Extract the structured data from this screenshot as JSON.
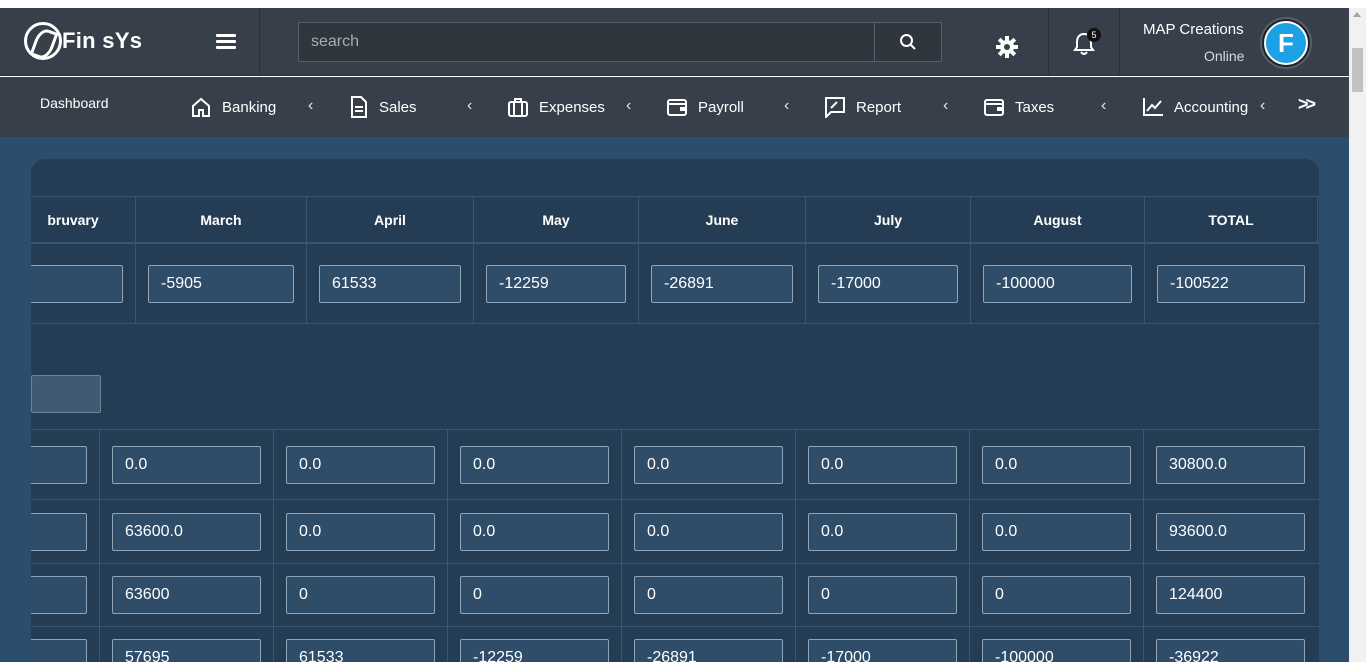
{
  "header": {
    "logo_text": "Fin sYs",
    "search_placeholder": "search",
    "notification_count": "5",
    "user_name": "MAP Creations",
    "user_status": "Online",
    "avatar_letter": "F"
  },
  "nav": {
    "items": [
      {
        "label": "Dashboard",
        "icon": "none"
      },
      {
        "label": "Banking",
        "icon": "home-icon"
      },
      {
        "label": "Sales",
        "icon": "document-icon"
      },
      {
        "label": "Expenses",
        "icon": "briefcase-icon"
      },
      {
        "label": "Payroll",
        "icon": "wallet-icon"
      },
      {
        "label": "Report",
        "icon": "edit-chart-icon"
      },
      {
        "label": "Taxes",
        "icon": "wallet-icon"
      },
      {
        "label": "Accounting",
        "icon": "line-chart-icon"
      }
    ],
    "more": ">>"
  },
  "table": {
    "columns": [
      "bruvary",
      "March",
      "April",
      "May",
      "June",
      "July",
      "August",
      "TOTAL"
    ],
    "totals_row": [
      "",
      "-5905",
      "61533",
      "-12259",
      "-26891",
      "-17000",
      "-100000",
      "-100522"
    ],
    "rows": [
      [
        "",
        "0.0",
        "0.0",
        "0.0",
        "0.0",
        "0.0",
        "0.0",
        "30800.0"
      ],
      [
        "",
        "63600.0",
        "0.0",
        "0.0",
        "0.0",
        "0.0",
        "0.0",
        "93600.0"
      ],
      [
        "",
        "63600",
        "0",
        "0",
        "0",
        "0",
        "0",
        "124400"
      ],
      [
        "",
        "57695",
        "61533",
        "-12259",
        "-26891",
        "-17000",
        "-100000",
        "-36922"
      ]
    ]
  },
  "colors": {
    "header_bg": "#37404a",
    "page_bg": "#2b4d6e",
    "card_bg": "#253d54",
    "input_bg": "#2f4c68",
    "avatar_accent": "#1da1e6"
  }
}
